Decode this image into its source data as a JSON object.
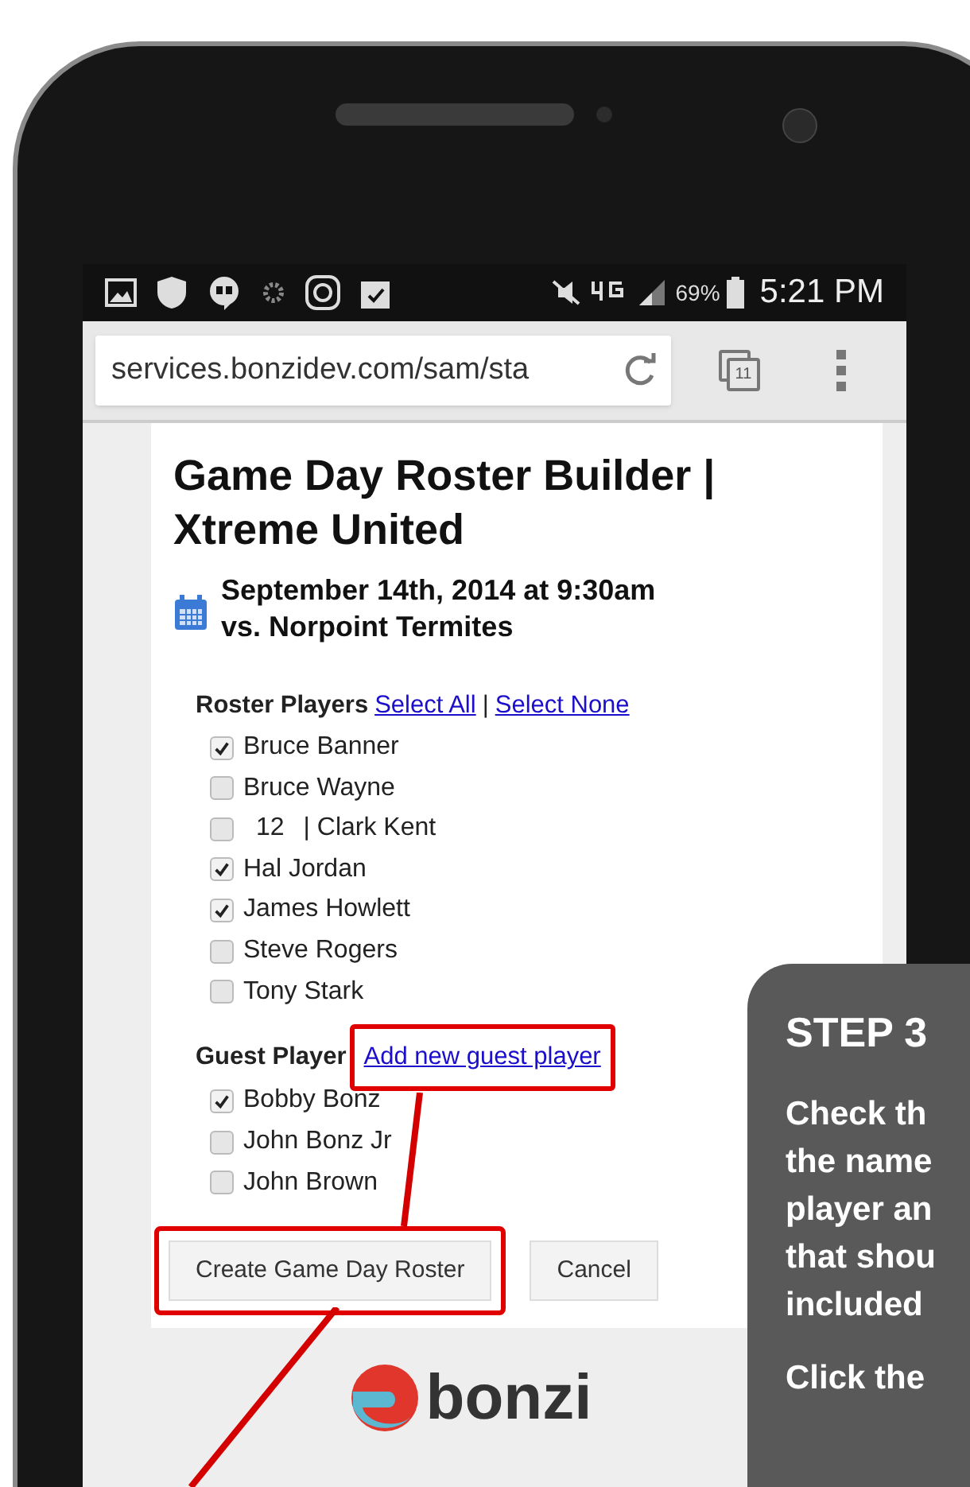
{
  "status_bar": {
    "battery": "69%",
    "time": "5:21 PM"
  },
  "browser": {
    "url": "services.bonzidev.com/sam/sta",
    "tab_count": "11"
  },
  "page": {
    "title_line_1": "Game Day Roster Builder |",
    "title_line_2": "Xtreme United",
    "event_date": "September 14th, 2014 at 9:30am",
    "opponent": "vs. Norpoint Termites",
    "roster_label": "Roster Players",
    "select_all": "Select All",
    "separator": "|",
    "select_none": "Select None",
    "roster_players": [
      {
        "label": "Bruce Banner",
        "checked": true
      },
      {
        "label": "Bruce Wayne",
        "checked": false
      },
      {
        "number": "12",
        "label": "| Clark Kent",
        "checked": false
      },
      {
        "label": "Hal Jordan",
        "checked": true
      },
      {
        "label": "James Howlett",
        "checked": true
      },
      {
        "label": "Steve Rogers",
        "checked": false
      },
      {
        "label": "Tony Stark",
        "checked": false
      }
    ],
    "guest_label": "Guest Player",
    "add_guest": {
      "label": "Add new guest player",
      "highlighted": true
    },
    "guest_players": [
      {
        "label": "Bobby Bonz",
        "checked": true
      },
      {
        "label": "John Bonz Jr",
        "checked": false
      },
      {
        "label": "John Brown",
        "checked": false
      }
    ],
    "buttons": [
      {
        "label": "Create Game Day Roster",
        "highlighted": true
      },
      {
        "label": "Cancel",
        "highlighted": false
      }
    ],
    "logo_text": "bonzi"
  },
  "callout": {
    "heading": "STEP 3",
    "lines": [
      "Check th",
      "the name",
      "player an",
      "that shou",
      "included"
    ],
    "last_line": "Click the"
  }
}
